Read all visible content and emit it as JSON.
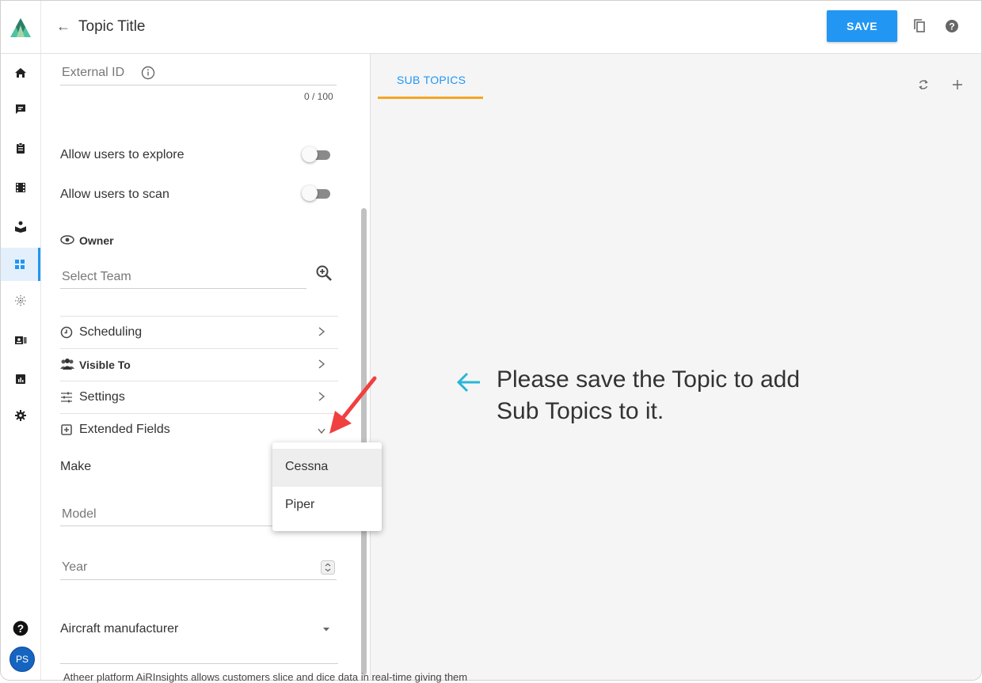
{
  "header": {
    "title": "Topic Title",
    "save_label": "SAVE"
  },
  "sidebar": {
    "items": [
      "home-icon",
      "chat-icon",
      "clipboard-icon",
      "film-icon",
      "learning-icon",
      "dashboard-icon",
      "sparkle-icon",
      "contact-card-icon",
      "chart-icon",
      "gear-icon"
    ],
    "active_item": "dashboard-icon",
    "avatar_initials": "PS"
  },
  "form": {
    "external_id": {
      "label": "External ID",
      "counter": "0 / 100"
    },
    "allow_explore": {
      "label": "Allow users to explore",
      "enabled": false
    },
    "allow_scan": {
      "label": "Allow users to scan",
      "enabled": false
    },
    "owner": {
      "label": "Owner",
      "placeholder": "Select Team"
    },
    "sections": [
      {
        "label": "Scheduling",
        "icon": "clock-icon"
      },
      {
        "label": "Visible To",
        "icon": "users-icon"
      },
      {
        "label": "Settings",
        "icon": "sliders-icon"
      },
      {
        "label": "Extended Fields",
        "icon": "extend-icon"
      }
    ],
    "extended": {
      "make_label": "Make",
      "model_label": "Model",
      "year_label": "Year",
      "aircraft_label": "Aircraft manufacturer"
    }
  },
  "dropdown": {
    "options": [
      "Cessna",
      "Piper"
    ],
    "hovered": "Cessna"
  },
  "right": {
    "tab_label": "SUB TOPICS",
    "empty_message_line1": "Please save the Topic to add",
    "empty_message_line2": "Sub Topics to it."
  },
  "footer": {
    "text": "Atheer platform AiRInsights allows customers slice and dice data in real-time giving them"
  },
  "colors": {
    "accent": "#2196f3",
    "tab_underline": "#f5a623",
    "annotation_arrow": "#f04040",
    "hint_arrow": "#29b6d8"
  }
}
